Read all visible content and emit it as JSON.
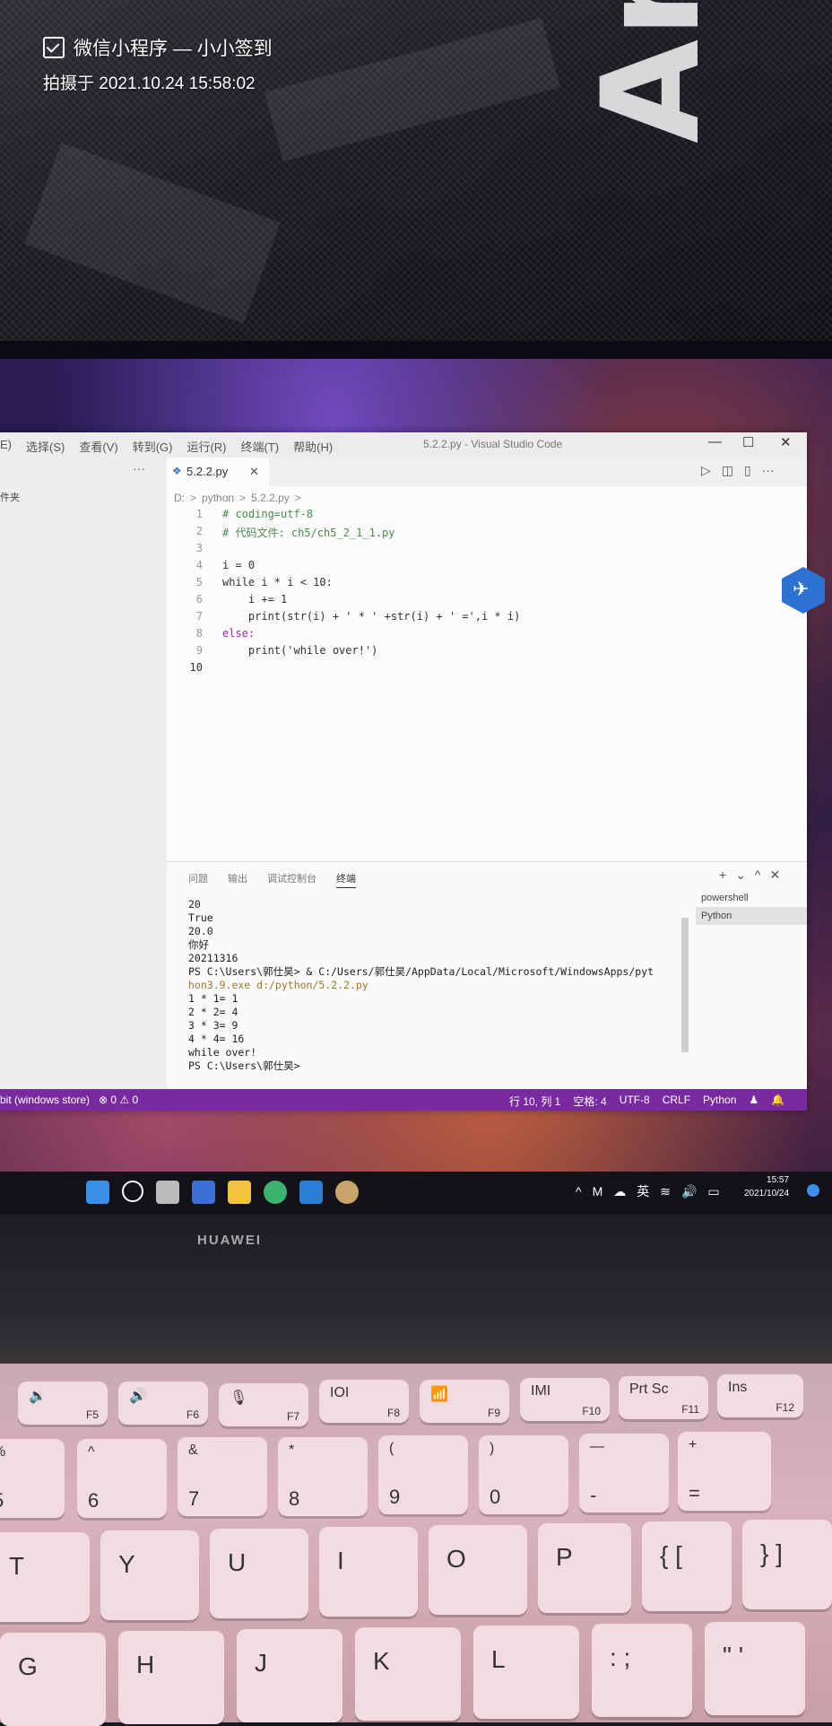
{
  "overlay": {
    "app_line": "微信小程序 — 小小签到",
    "taken_line": "拍摄于 2021.10.24 15:58:02"
  },
  "vscode": {
    "menu": [
      "E)",
      "选择(S)",
      "查看(V)",
      "转到(G)",
      "运行(R)",
      "终端(T)",
      "帮助(H)"
    ],
    "window_title": "5.2.2.py - Visual Studio Code",
    "sidebar_label": "件夹",
    "tab_label": "5.2.2.py",
    "breadcrumb": [
      "D:",
      ">",
      "python",
      ">",
      "5.2.2.py",
      ">"
    ],
    "code_lines": [
      {
        "n": "1",
        "t": "# coding=utf-8"
      },
      {
        "n": "2",
        "t": "# 代码文件: ch5/ch5_2_1_1.py"
      },
      {
        "n": "3",
        "t": ""
      },
      {
        "n": "4",
        "t": "i = 0"
      },
      {
        "n": "5",
        "t": "while i * i < 10:"
      },
      {
        "n": "6",
        "t": "    i += 1"
      },
      {
        "n": "7",
        "t": "    print(str(i) + ' * ' +str(i) + ' =',i * i)"
      },
      {
        "n": "8",
        "t": "else:"
      },
      {
        "n": "9",
        "t": "    print('while over!')"
      },
      {
        "n": "10",
        "t": ""
      }
    ],
    "panel_tabs": [
      "问题",
      "输出",
      "调试控制台",
      "终端"
    ],
    "terminal_lines": [
      "20",
      "True",
      "20.0",
      "你好",
      "20211316",
      "PS C:\\Users\\郭仕昊> & C:/Users/郭仕昊/AppData/Local/Microsoft/WindowsApps/pyt",
      "hon3.9.exe d:/python/5.2.2.py",
      "1 * 1= 1",
      "2 * 2= 4",
      "3 * 3= 9",
      "4 * 4= 16",
      "while over!",
      "PS C:\\Users\\郭仕昊> "
    ],
    "terminal_list": [
      "powershell",
      "Python"
    ],
    "status_left": "bit (windows store)",
    "status_errors": "⊗ 0 ⚠ 0",
    "status_right": [
      "行 10, 列 1",
      "空格: 4",
      "UTF-8",
      "CRLF",
      "Python"
    ]
  },
  "taskbar": {
    "ime": "英",
    "time": "15:57",
    "date": "2021/10/24"
  },
  "laptop": {
    "brand": "HUAWEI"
  },
  "keyboard": {
    "frow": [
      {
        "top": "🔉",
        "fn": "F5"
      },
      {
        "top": "🔊",
        "fn": "F6"
      },
      {
        "top": "🎙",
        "fn": "F7"
      },
      {
        "top": "IOI",
        "fn": "F8"
      },
      {
        "top": "📶",
        "fn": "F9"
      },
      {
        "top": "IMI",
        "fn": "F10"
      },
      {
        "top": "Prt Sc",
        "fn": "F11"
      },
      {
        "top": "Ins",
        "fn": "F12"
      }
    ],
    "num": [
      {
        "top": "%",
        "bot": "5"
      },
      {
        "top": "^",
        "bot": "6"
      },
      {
        "top": "&",
        "bot": "7"
      },
      {
        "top": "*",
        "bot": "8"
      },
      {
        "top": "(",
        "bot": "9"
      },
      {
        "top": ")",
        "bot": "0"
      },
      {
        "top": "—",
        "bot": "-"
      },
      {
        "top": "+",
        "bot": "="
      }
    ],
    "row2": [
      "T",
      "Y",
      "U",
      "I",
      "O",
      "P",
      "{ [",
      "} ]"
    ],
    "row3": [
      "G",
      "H",
      "J",
      "K",
      "L",
      ": ;",
      "\" '"
    ]
  }
}
